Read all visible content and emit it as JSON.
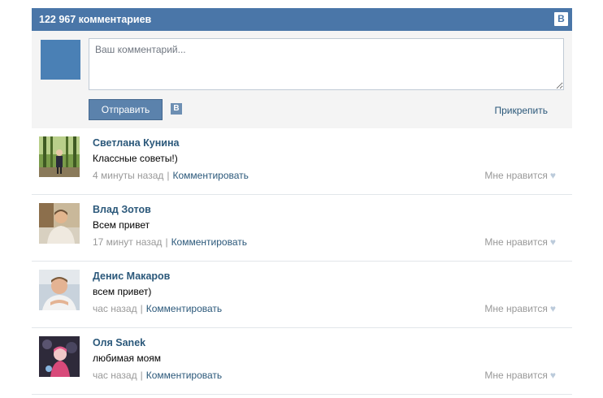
{
  "header": {
    "count_title": "122 967 комментариев",
    "badge": "B"
  },
  "compose": {
    "placeholder": "Ваш комментарий...",
    "send_label": "Отправить",
    "vk_badge": "B",
    "attach_label": "Прикрепить"
  },
  "comments": [
    {
      "author": "Светлана Кунина",
      "text": "Классные советы!)",
      "time": "4 минуты назад",
      "reply_label": "Комментировать",
      "like_label": "Мне нравится"
    },
    {
      "author": "Влад Зотов",
      "text": "Всем привет",
      "time": "17 минут назад",
      "reply_label": "Комментировать",
      "like_label": "Мне нравится"
    },
    {
      "author": "Денис Макаров",
      "text": "всем привет)",
      "time": "час назад",
      "reply_label": "Комментировать",
      "like_label": "Мне нравится"
    },
    {
      "author": "Оля Sanek",
      "text": "любимая моям",
      "time": "час назад",
      "reply_label": "Комментировать",
      "like_label": "Мне нравится"
    }
  ],
  "colors": {
    "header_bg": "#4a76a8",
    "link": "#2b587a",
    "compose_bg": "#f4f4f4"
  }
}
